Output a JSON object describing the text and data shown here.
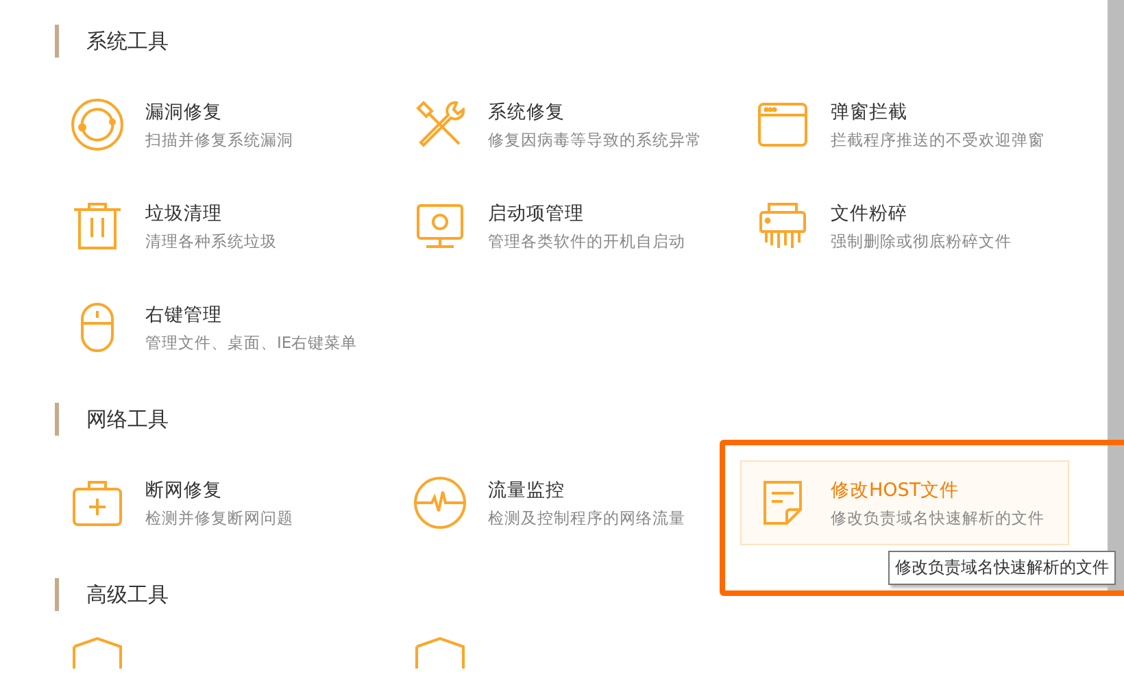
{
  "sections": [
    {
      "title": "系统工具",
      "items": [
        {
          "title": "漏洞修复",
          "description": "扫描并修复系统漏洞",
          "highlighted": false
        },
        {
          "title": "系统修复",
          "description": "修复因病毒等导致的系统异常",
          "highlighted": false
        },
        {
          "title": "弹窗拦截",
          "description": "拦截程序推送的不受欢迎弹窗",
          "highlighted": false
        },
        {
          "title": "垃圾清理",
          "description": "清理各种系统垃圾",
          "highlighted": false
        },
        {
          "title": "启动项管理",
          "description": "管理各类软件的开机自启动",
          "highlighted": false
        },
        {
          "title": "文件粉碎",
          "description": "强制删除或彻底粉碎文件",
          "highlighted": false
        },
        {
          "title": "右键管理",
          "description": "管理文件、桌面、IE右键菜单",
          "highlighted": false
        }
      ]
    },
    {
      "title": "网络工具",
      "items": [
        {
          "title": "断网修复",
          "description": "检测并修复断网问题",
          "highlighted": false
        },
        {
          "title": "流量监控",
          "description": "检测及控制程序的网络流量",
          "highlighted": false
        },
        {
          "title": "修改HOST文件",
          "description": "修改负责域名快速解析的文件",
          "highlighted": true,
          "tooltip": "修改负责域名快速解析的文件"
        }
      ]
    },
    {
      "title": "高级工具"
    }
  ]
}
